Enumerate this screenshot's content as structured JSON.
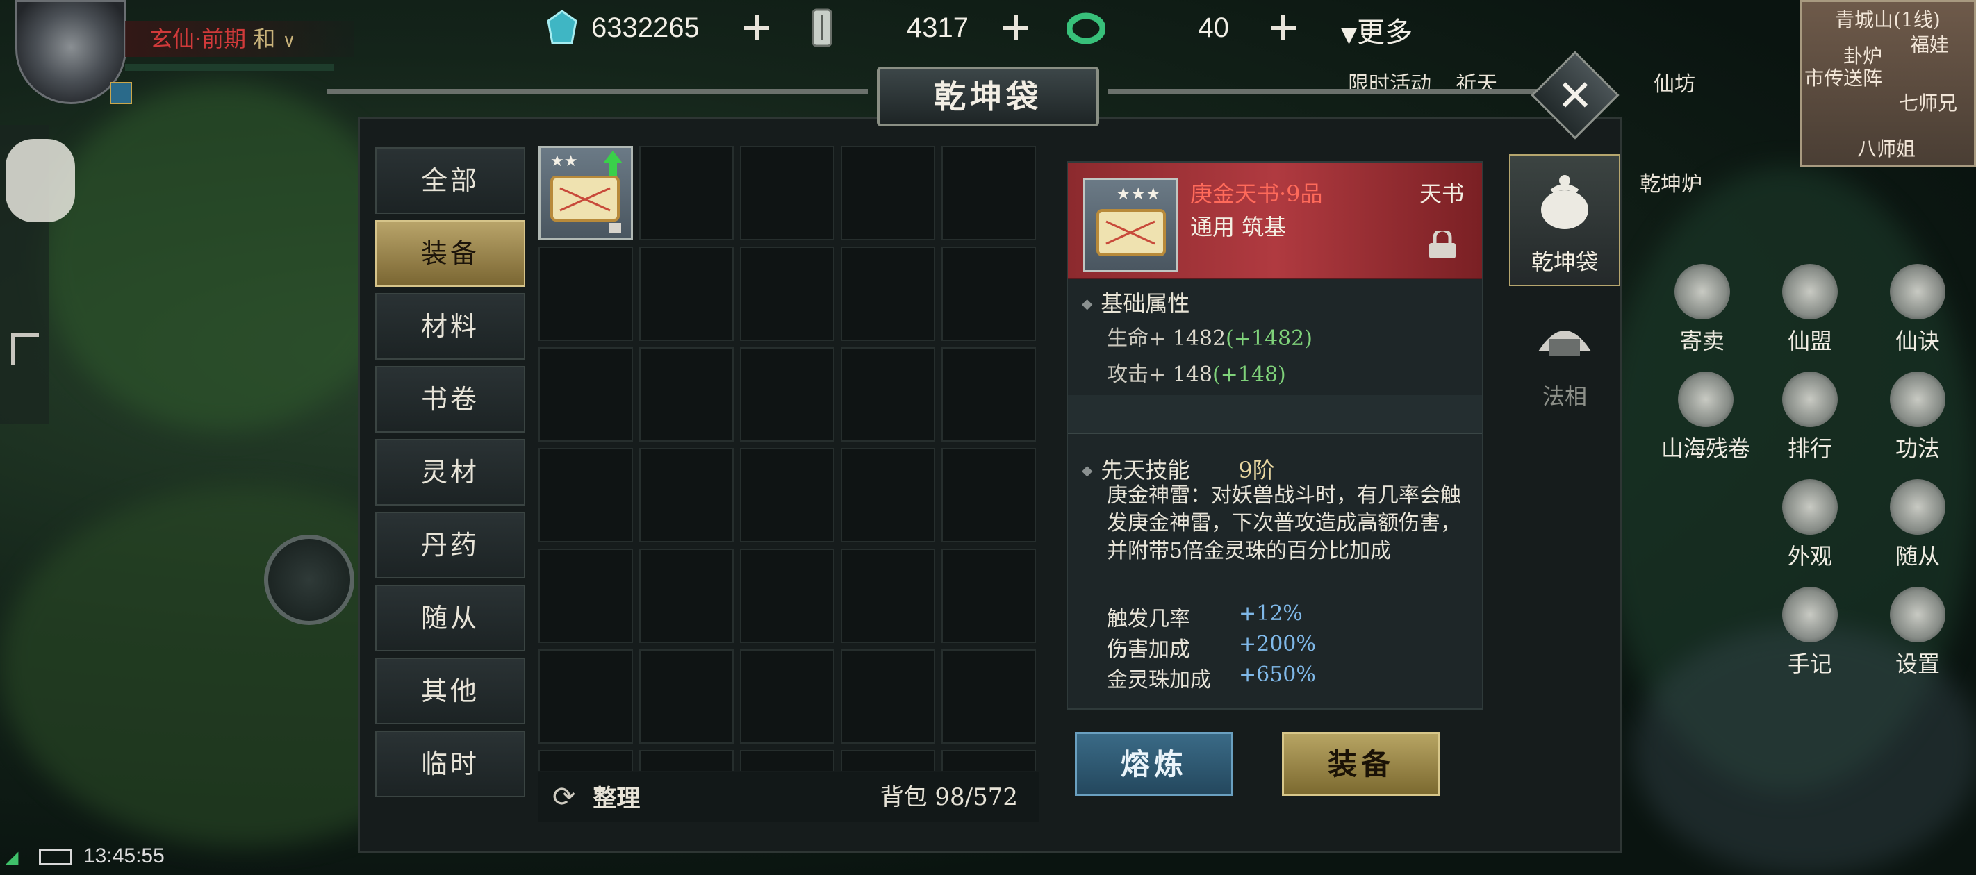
{
  "hud": {
    "name_prefix": "玄仙·前期",
    "name_suffix": "和",
    "chevron": "∨"
  },
  "resources": [
    {
      "icon": "crystal-icon",
      "value": "6332265"
    },
    {
      "icon": "jade-token-icon",
      "value": "4317"
    },
    {
      "icon": "jade-ring-icon",
      "value": "40"
    }
  ],
  "more_label": "更多",
  "top_icons": [
    {
      "label": "限时活动"
    },
    {
      "label": "祈天"
    },
    {
      "label": "仙坊"
    }
  ],
  "minimap": {
    "line": "青城山(1线)",
    "label_a": "福娃",
    "label_b": "市传送阵",
    "label_c": "七师兄",
    "label_d": "八师姐",
    "label_e": "卦炉"
  },
  "panel": {
    "title": "乾坤袋",
    "close": "✕"
  },
  "categories": [
    "全部",
    "装备",
    "材料",
    "书卷",
    "灵材",
    "丹药",
    "随从",
    "其他",
    "临时"
  ],
  "active_category": 1,
  "bag": {
    "sort_label": "整理",
    "capacity_label": "背包",
    "capacity_value": "98/572"
  },
  "detail": {
    "name": "庚金天书·9品",
    "type": "天书",
    "sub": "通用 筑基",
    "base_title": "基础属性",
    "stats": [
      {
        "label": "生命+",
        "value": "1482",
        "bonus": "(+1482)"
      },
      {
        "label": "攻击+",
        "value": "148",
        "bonus": "(+148)"
      }
    ],
    "skill_title": "先天技能",
    "skill_level": "9阶",
    "skill_desc": "庚金神雷：对妖兽战斗时，有几率会触发庚金神雷，下次普攻造成高额伤害，并附带5倍金灵珠的百分比加成",
    "skill_stats": [
      {
        "label": "触发几率",
        "value": "+12%"
      },
      {
        "label": "伤害加成",
        "value": "+200%"
      },
      {
        "label": "金灵珠加成",
        "value": "+650%"
      }
    ]
  },
  "buttons": {
    "smelt": "熔炼",
    "equip": "装备"
  },
  "side_tabs": [
    {
      "label": "乾坤袋",
      "icon": "pouch-icon"
    },
    {
      "label": "法相",
      "icon": "dharma-form-icon"
    }
  ],
  "right_menu": [
    {
      "label": "寄卖",
      "icon": "coin-icon"
    },
    {
      "label": "仙盟",
      "icon": "banner-icon"
    },
    {
      "label": "仙诀",
      "icon": "scroll-icon"
    },
    {
      "label": "山海残卷",
      "icon": "beast-icon"
    },
    {
      "label": "排行",
      "icon": "ranking-icon"
    },
    {
      "label": "功法",
      "icon": "yinyang-icon"
    },
    {
      "label": "外观",
      "icon": "brush-icon"
    },
    {
      "label": "随从",
      "icon": "companion-icon"
    },
    {
      "label": "手记",
      "icon": "notebook-icon"
    },
    {
      "label": "设置",
      "icon": "gear-icon"
    }
  ],
  "right_top": {
    "label": "乾坤炉"
  },
  "status": {
    "time": "13:45:55"
  },
  "colors": {
    "accent_gold": "#b9a46a",
    "item_red": "#b03a40",
    "stat_green": "#7fd27a",
    "skill_blue": "#7fb8e8"
  }
}
